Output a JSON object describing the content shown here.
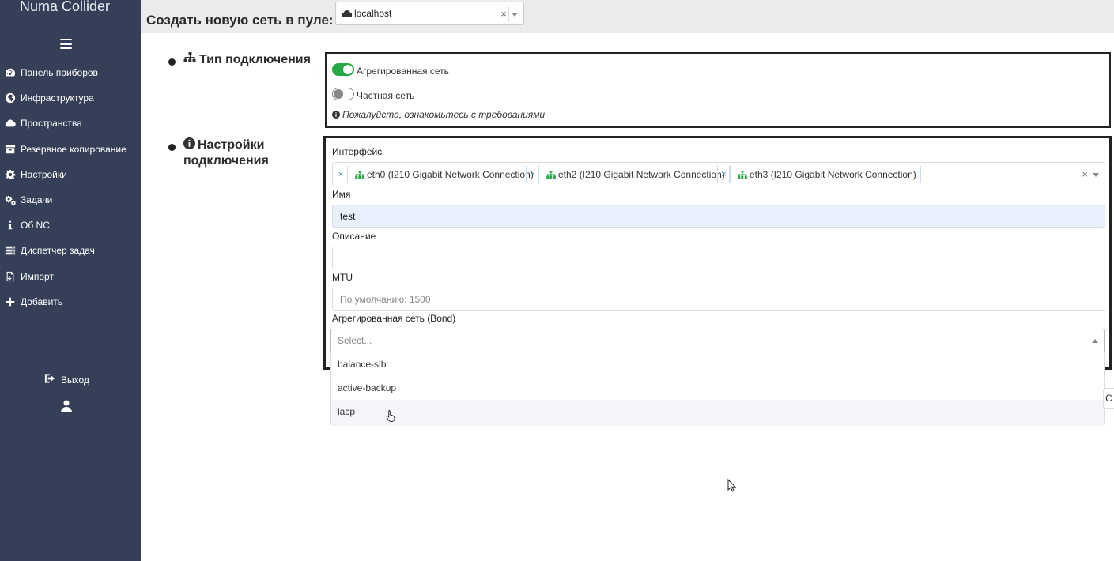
{
  "app": {
    "brand": "Numa Collider"
  },
  "sidebar": {
    "items": [
      {
        "label": "Панель приборов",
        "icon": "dashboard-icon"
      },
      {
        "label": "Инфраструктура",
        "icon": "globe-icon"
      },
      {
        "label": "Пространства",
        "icon": "cloud-icon"
      },
      {
        "label": "Резервное копирование",
        "icon": "archive-icon"
      },
      {
        "label": "Настройки",
        "icon": "gear-icon"
      },
      {
        "label": "Задачи",
        "icon": "gears-icon"
      },
      {
        "label": "Об NC",
        "icon": "info-icon"
      },
      {
        "label": "Диспетчер задач",
        "icon": "tasks-icon"
      },
      {
        "label": "Импорт",
        "icon": "file-import-icon"
      },
      {
        "label": "Добавить",
        "icon": "plus-icon"
      }
    ],
    "logout_label": "Выход"
  },
  "header": {
    "title": "Создать новую сеть в пуле:",
    "pool_value": "localhost",
    "clear_symbol": "×"
  },
  "steps": {
    "connection_type": "Тип подключения",
    "connection_settings_line1": "Настройки",
    "connection_settings_line2": "подключения"
  },
  "connection_type": {
    "bonded_label": "Агрегированная сеть",
    "bonded_on": true,
    "private_label": "Частная сеть",
    "private_on": false,
    "notice": "Пожалуйста, ознакомьтесь с требованиями",
    "info_symbol": "i"
  },
  "settings": {
    "interface_label": "Интерфейс",
    "interfaces": [
      "eth0 (I210 Gigabit Network Connection)",
      "eth2 (I210 Gigabit Network Connection)",
      "eth3 (I210 Gigabit Network Connection)"
    ],
    "tag_remove_symbol": "×",
    "name_label": "Имя",
    "name_value": "test",
    "description_label": "Описание",
    "description_value": "",
    "mtu_label": "MTU",
    "mtu_placeholder": "По умолчанию: 1500",
    "bond_label": "Агрегированная сеть (Bond)",
    "bond_placeholder": "Select...",
    "bond_options": [
      "balance-slb",
      "active-backup",
      "lacp"
    ],
    "hovered_option": "lacp",
    "peek_text": "С"
  },
  "colors": {
    "sidebar_bg": "#354058",
    "topbar_bg": "#ebebeb",
    "toggle_on": "#28a745",
    "tag_icon": "#28a745",
    "tag_remove": "#2a8bd8",
    "name_input_bg": "#e8f0fe"
  }
}
